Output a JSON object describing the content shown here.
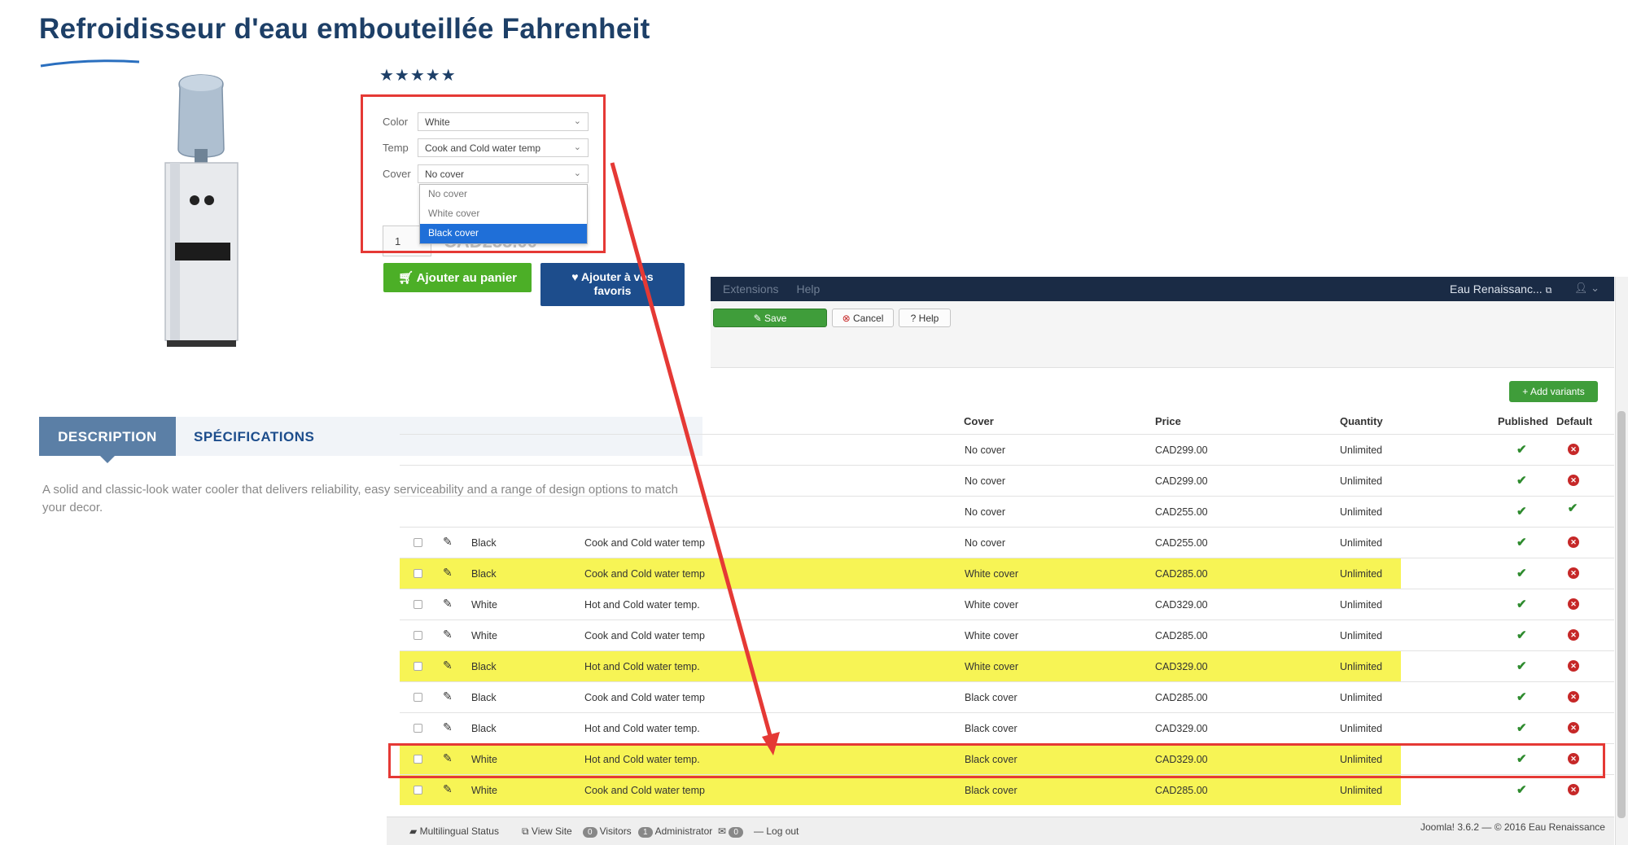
{
  "product": {
    "title": "Refroidisseur d'eau embouteillée Fahrenheit",
    "rating_stars": 5,
    "stars_text": "★★★★★",
    "options": {
      "color_label": "Color",
      "color_value": "White",
      "temp_label": "Temp",
      "temp_value": "Cook and Cold water temp",
      "cover_label": "Cover",
      "cover_value": "No cover",
      "cover_options": [
        "No cover",
        "White cover",
        "Black cover"
      ],
      "highlighted_option": "Black cover"
    },
    "quantity": "1",
    "price_partial": "CAD255.00",
    "add_to_cart": "Ajouter au panier",
    "add_to_favorites": "Ajouter à vos favoris",
    "tabs": {
      "description": "DESCRIPTION",
      "specifications": "SPÉCIFICATIONS"
    },
    "description": "A solid and classic-look water cooler that delivers reliability, easy serviceability and a range of design options to match your decor."
  },
  "admin": {
    "menu": [
      "Extensions",
      "Help"
    ],
    "site_name": "Eau Renaissanc...",
    "toolbar": {
      "save": "Save",
      "cancel": "Cancel",
      "help": "Help"
    },
    "add_variants": "Add variants",
    "columns": {
      "cover": "Cover",
      "price": "Price",
      "quantity": "Quantity",
      "published": "Published",
      "default": "Default"
    },
    "rows": [
      {
        "color": "",
        "temp": "",
        "cover": "No cover",
        "price": "CAD299.00",
        "qty": "Unlimited"
      },
      {
        "color": "",
        "temp": "",
        "cover": "No cover",
        "price": "CAD299.00",
        "qty": "Unlimited"
      },
      {
        "color": "",
        "temp": "",
        "cover": "No cover",
        "price": "CAD255.00",
        "qty": "Unlimited"
      },
      {
        "color": "Black",
        "temp": "Cook and Cold water temp",
        "cover": "No cover",
        "price": "CAD255.00",
        "qty": "Unlimited"
      },
      {
        "color": "Black",
        "temp": "Cook and Cold water temp",
        "cover": "White cover",
        "price": "CAD285.00",
        "qty": "Unlimited"
      },
      {
        "color": "White",
        "temp": "Hot and Cold water temp.",
        "cover": "White cover",
        "price": "CAD329.00",
        "qty": "Unlimited"
      },
      {
        "color": "White",
        "temp": "Cook and Cold water temp",
        "cover": "White cover",
        "price": "CAD285.00",
        "qty": "Unlimited"
      },
      {
        "color": "Black",
        "temp": "Hot and Cold water temp.",
        "cover": "White cover",
        "price": "CAD329.00",
        "qty": "Unlimited"
      },
      {
        "color": "Black",
        "temp": "Cook and Cold water temp",
        "cover": "Black cover",
        "price": "CAD285.00",
        "qty": "Unlimited"
      },
      {
        "color": "Black",
        "temp": "Hot and Cold water temp.",
        "cover": "Black cover",
        "price": "CAD329.00",
        "qty": "Unlimited"
      },
      {
        "color": "White",
        "temp": "Hot and Cold water temp.",
        "cover": "Black cover",
        "price": "CAD329.00",
        "qty": "Unlimited"
      },
      {
        "color": "White",
        "temp": "Cook and Cold water temp",
        "cover": "Black cover",
        "price": "CAD285.00",
        "qty": "Unlimited"
      }
    ],
    "status": {
      "multilingual": "Multilingual Status",
      "view_site": "View Site",
      "visitors_count": "0",
      "visitors": "Visitors",
      "admin_count": "1",
      "administrator": "Administrator",
      "mail_count": "0",
      "logout": "Log out",
      "version": "Joomla! 3.6.2 — © 2016 Eau Renaissance"
    }
  },
  "colors": {
    "title": "#1d3f67",
    "cart_green": "#4caf27",
    "fav_blue": "#1d4d8c",
    "highlight_yellow": "#f7f455",
    "annotation_red": "#e53935",
    "admin_bar": "#1a2b45"
  }
}
